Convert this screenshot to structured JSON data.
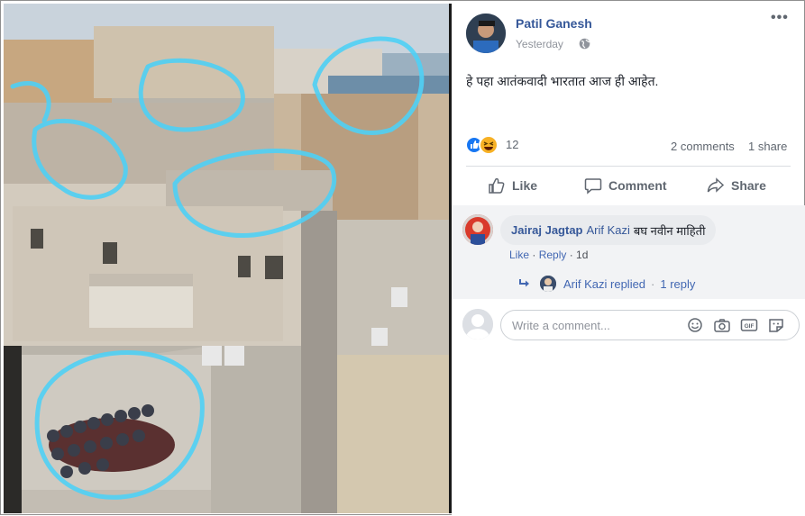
{
  "post": {
    "author_name": "Patil Ganesh",
    "timestamp": "Yesterday",
    "privacy_icon": "globe-icon",
    "more_icon": "ellipsis-icon",
    "more_label": "•••",
    "text": "हे पहा आतंकवादी भारतात आज ही आहेत.",
    "image_alt_icon": "rooftop-photo"
  },
  "reactions": {
    "types": [
      "like",
      "haha"
    ],
    "count": "12",
    "comments": "2 comments",
    "shares": "1 share"
  },
  "actions": {
    "like": "Like",
    "comment": "Comment",
    "share": "Share"
  },
  "comment": {
    "author": "Jairaj Jagtap",
    "mention": "Arif Kazi",
    "text": "बघ नवीन माहिती",
    "like_link": "Like",
    "separator": " · ",
    "reply_link": "Reply",
    "time": "1d",
    "replied_by": "Arif Kazi replied",
    "reply_separator": "·",
    "reply_count": "1 reply"
  },
  "composer": {
    "placeholder": "Write a comment...",
    "icons": [
      "emoji-icon",
      "camera-icon",
      "gif-icon",
      "sticker-icon"
    ]
  },
  "colors": {
    "link": "#365899",
    "meta": "#606770",
    "like_blue": "#1877f2",
    "haha_yellow": "#f7b125",
    "annotation_circle": "#4fd0f5"
  }
}
